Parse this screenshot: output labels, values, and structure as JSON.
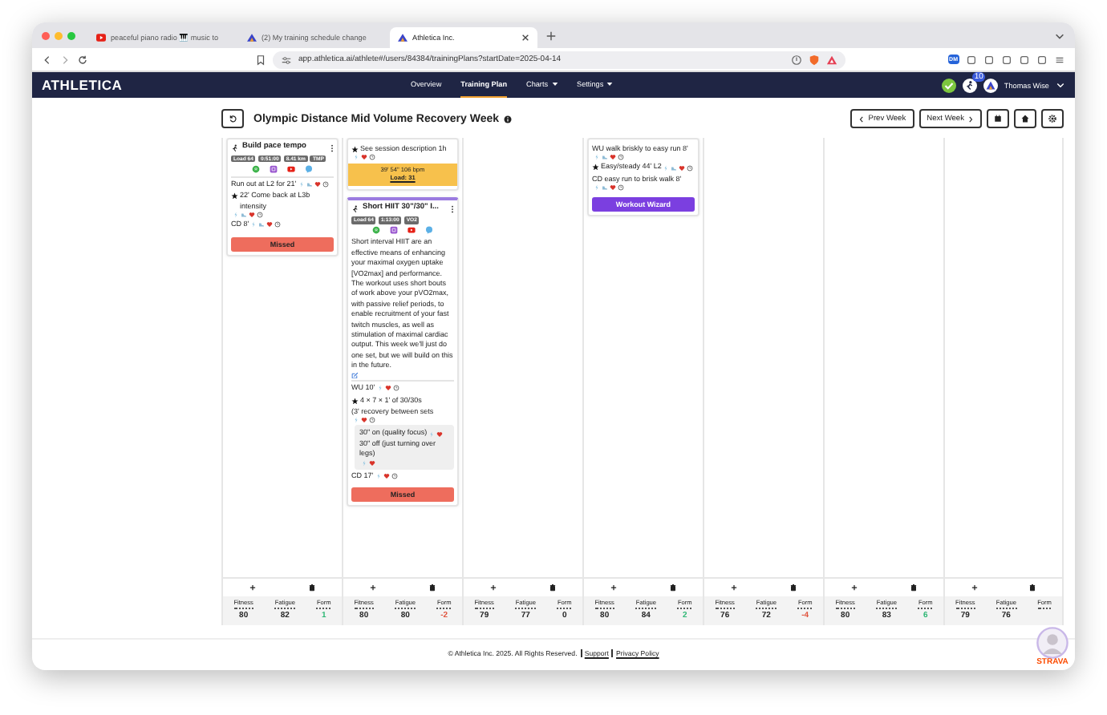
{
  "browser": {
    "tabs": [
      {
        "title": "peaceful piano radio 🎹 music to",
        "kind": "video",
        "selected": false
      },
      {
        "title": "(2) My training schedule change",
        "kind": "app",
        "selected": false
      },
      {
        "title": "Athletica Inc.",
        "kind": "app",
        "selected": true
      }
    ],
    "url": "app.athletica.ai/athlete#/users/84384/trainingPlans?startDate=2025-04-14",
    "extension_badge": "DM"
  },
  "nav": {
    "logo": "ATHLETICA",
    "links": [
      {
        "label": "Overview",
        "selected": false,
        "dropdown": false
      },
      {
        "label": "Training Plan",
        "selected": true,
        "dropdown": false
      },
      {
        "label": "Charts",
        "selected": false,
        "dropdown": true
      },
      {
        "label": "Settings",
        "selected": false,
        "dropdown": true
      }
    ],
    "notifications": "10",
    "user": "Thomas Wise"
  },
  "header": {
    "title": "Olympic Distance Mid Volume Recovery Week",
    "prev": "Prev Week",
    "next": "Next Week"
  },
  "days": [
    {
      "cards": [
        {
          "title": "Build pace tempo",
          "tags": [
            "Load 64",
            "0:51:00",
            "8.41 km",
            "TMP"
          ],
          "media": true,
          "steps": [
            {
              "text": "Run out at L2 for 21'",
              "key": false,
              "shoe": true
            },
            {
              "text": "22' Come back at L3b intensity",
              "key": true,
              "shoe": true
            },
            {
              "text": "CD 8'",
              "key": false,
              "shoe": true
            }
          ],
          "action": {
            "label": "Missed",
            "kind": "missed"
          }
        }
      ],
      "metrics": [
        {
          "label": "Fitness",
          "value": "80"
        },
        {
          "label": "Fatigue",
          "value": "82"
        },
        {
          "label": "Form",
          "value": "1",
          "color": "#2bb673"
        }
      ]
    },
    {
      "cards": [
        {
          "steps": [
            {
              "text": "See session description 1h",
              "key": true,
              "shoe": false
            }
          ],
          "note": {
            "line": "39' 54\"  106 bpm",
            "load": "Load: 31"
          }
        },
        {
          "title": "Short HIIT 30\"/30\" I...",
          "tags": [
            "Load 64",
            "1:13:00",
            "VO2"
          ],
          "media": true,
          "selected": true,
          "description": "Short interval HIIT are an effective means of enhancing your maximal oxygen uptake [VO2max] and performance. The workout uses short bouts of work above your pVO2max, with passive relief periods, to enable recruitment of your fast twitch muscles, as well as stimulation of maximal cardiac output. This week we'll just do one set, but we will build on this in the future.",
          "steps": [
            {
              "text": "WU 10'",
              "key": false,
              "shoe": false
            },
            {
              "text": "4 × 7 × 1' of 30/30s",
              "key": true,
              "plain": true
            },
            {
              "text": "(3' recovery between sets",
              "key": false,
              "shoe": false
            },
            {
              "group": [
                {
                  "text": "30\" on (quality focus)",
                  "shoe": false,
                  "noclock": true
                },
                {
                  "text": "30\" off (just turning over legs)",
                  "shoe": false,
                  "noclock": true
                }
              ]
            },
            {
              "text": "CD 17'",
              "key": false,
              "shoe": false
            }
          ],
          "action": {
            "label": "Missed",
            "kind": "missed"
          }
        }
      ],
      "metrics": [
        {
          "label": "Fitness",
          "value": "80"
        },
        {
          "label": "Fatigue",
          "value": "80"
        },
        {
          "label": "Form",
          "value": "-2",
          "color": "#e0533d"
        }
      ]
    },
    {
      "metrics": [
        {
          "label": "Fitness",
          "value": "79"
        },
        {
          "label": "Fatigue",
          "value": "77"
        },
        {
          "label": "Form",
          "value": "0"
        }
      ]
    },
    {
      "cards": [
        {
          "steps": [
            {
              "text": "WU walk briskly to easy run 8'",
              "key": false,
              "shoe": true
            },
            {
              "text": "Easy/steady 44' L2",
              "key": true,
              "shoe": true
            },
            {
              "text": "CD easy run to brisk walk 8'",
              "key": false,
              "shoe": true
            }
          ],
          "action": {
            "label": "Workout Wizard",
            "kind": "wizard"
          }
        }
      ],
      "metrics": [
        {
          "label": "Fitness",
          "value": "80"
        },
        {
          "label": "Fatigue",
          "value": "84"
        },
        {
          "label": "Form",
          "value": "2",
          "color": "#2bb673"
        }
      ]
    },
    {
      "metrics": [
        {
          "label": "Fitness",
          "value": "76"
        },
        {
          "label": "Fatigue",
          "value": "72"
        },
        {
          "label": "Form",
          "value": "-4",
          "color": "#e0533d"
        }
      ]
    },
    {
      "metrics": [
        {
          "label": "Fitness",
          "value": "80"
        },
        {
          "label": "Fatigue",
          "value": "83"
        },
        {
          "label": "Form",
          "value": "6",
          "color": "#2bb673"
        }
      ]
    },
    {
      "metrics": [
        {
          "label": "Fitness",
          "value": "79"
        },
        {
          "label": "Fatigue",
          "value": "76"
        },
        {
          "label": "Form"
        }
      ]
    }
  ],
  "footer": {
    "text": "© Athletica Inc. 2025. All Rights Reserved.",
    "links": [
      "Support",
      "Privacy Policy"
    ]
  },
  "strava": "STRAVA"
}
